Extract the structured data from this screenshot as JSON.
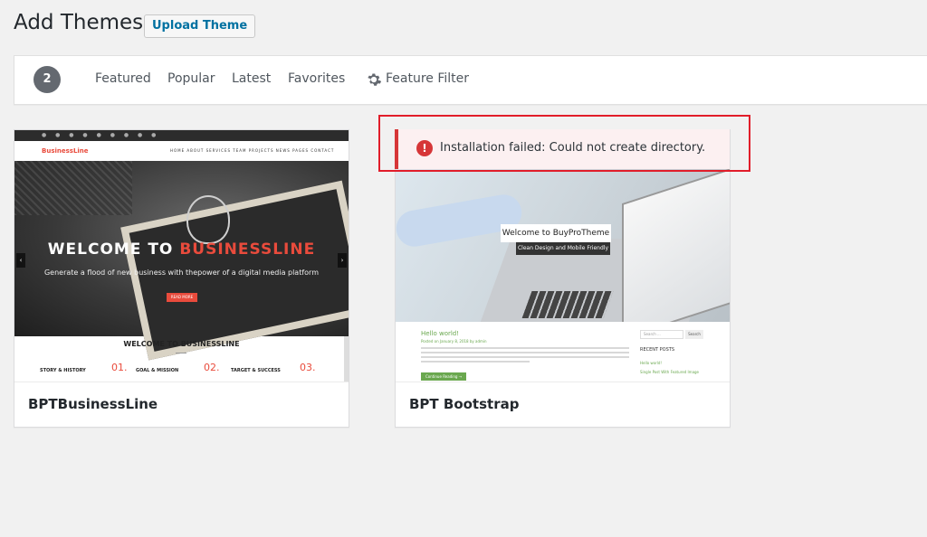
{
  "header": {
    "title": "Add Themes",
    "upload_label": "Upload Theme"
  },
  "filter_bar": {
    "count": "2",
    "tabs": [
      "Featured",
      "Popular",
      "Latest",
      "Favorites"
    ],
    "feature_filter_label": "Feature Filter"
  },
  "themes": [
    {
      "name": "BPTBusinessLine",
      "preview": {
        "logo": "BusinessLine",
        "menu": "HOME   ABOUT   SERVICES   TEAM   PROJECTS   NEWS   PAGES   CONTACT",
        "headline_start": "WELCOME TO ",
        "headline_accent": "BUSINESSLINE",
        "subheadline": "Generate a flood of new business with thepower of a digital media platform",
        "read_more": "READ MORE",
        "section_title": "WELCOME TO BUSINESSLINE",
        "columns": [
          {
            "label": "STORY & HISTORY",
            "number": "01."
          },
          {
            "label": "GOAL & MISSION",
            "number": "02."
          },
          {
            "label": "TARGET & SUCCESS",
            "number": "03."
          }
        ]
      }
    },
    {
      "name": "BPT Bootstrap",
      "preview": {
        "welcome": "Welcome to BuyProTheme",
        "tagline": "Clean Design and Mobile Friendly",
        "post_title": "Hello world!",
        "posted": "Posted on January 8, 2018 by admin",
        "continue": "Continue Reading →",
        "search_placeholder": "Search ...",
        "search_button": "Search",
        "recent_posts": "RECENT POSTS",
        "recent_links": [
          "Hello world!",
          "Single Post With Featured Image"
        ]
      }
    }
  ],
  "notice": {
    "message": "Installation failed: Could not create directory.",
    "icon": "!",
    "color": "#d63638"
  },
  "colors": {
    "highlight": "#e11d2a",
    "accent": "#0071a1"
  }
}
